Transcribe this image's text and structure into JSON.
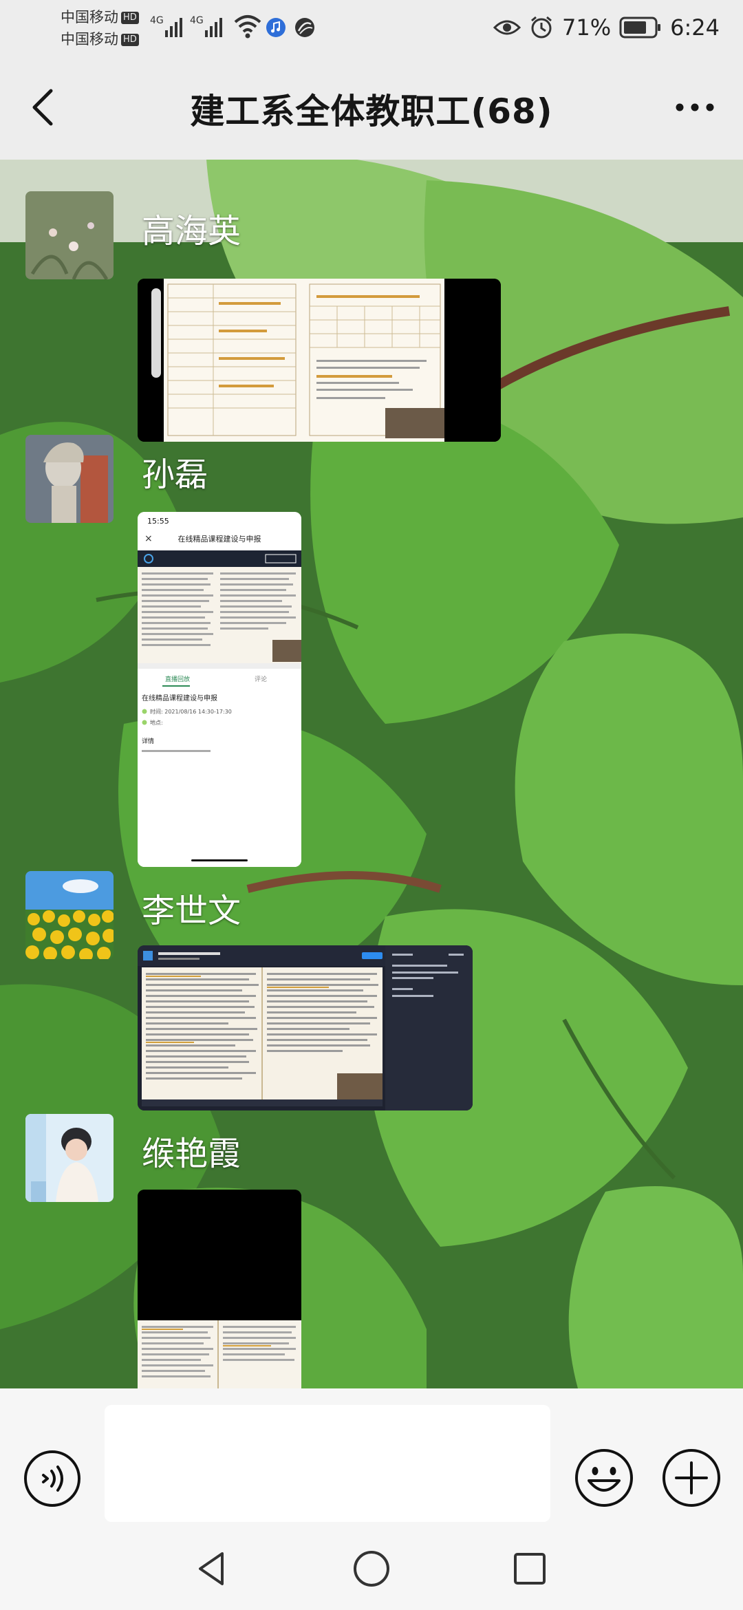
{
  "status_bar": {
    "carrier_1": "中国移动",
    "carrier_2": "中国移动",
    "hd_label": "HD",
    "network_1": "4G",
    "network_2": "4G",
    "battery": "71%",
    "time": "6:24",
    "icons": [
      "signal-icon",
      "wifi-icon",
      "music-icon",
      "browser-icon",
      "eye-icon",
      "alarm-icon",
      "battery-icon"
    ]
  },
  "header": {
    "title": "建工系全体教职工(68)",
    "back_icon": "back-arrow-icon",
    "more_icon": "more-dots-icon"
  },
  "messages": [
    {
      "sender": "高海英",
      "type": "image",
      "content": "document screenshot"
    },
    {
      "sender": "孙磊",
      "type": "image",
      "content": "phone screenshot"
    },
    {
      "sender": "李世文",
      "type": "image",
      "content": "video screenshot"
    },
    {
      "sender": "缑艳霞",
      "type": "image",
      "content": "phone screenshot"
    }
  ],
  "phone_shot": {
    "time": "15:55",
    "title": "在线精品课程建设与申报",
    "item_title": "在线精品课程建设与申报",
    "date_line": "时间: 2021/08/16 14:30-17:30",
    "extra_line": "地点:",
    "section": "详情"
  },
  "input_bar": {
    "value": "",
    "placeholder": "",
    "voice_icon": "voice-icon",
    "emoji_icon": "emoji-icon",
    "plus_icon": "plus-icon"
  },
  "nav_bar": {
    "icons": [
      "back-triangle-icon",
      "home-circle-icon",
      "recent-square-icon"
    ]
  },
  "colors": {
    "chrome": "#ededed",
    "input_bar": "#f6f6f6",
    "leaf_green": "#6bbd46",
    "sender_text": "#ffffff"
  }
}
